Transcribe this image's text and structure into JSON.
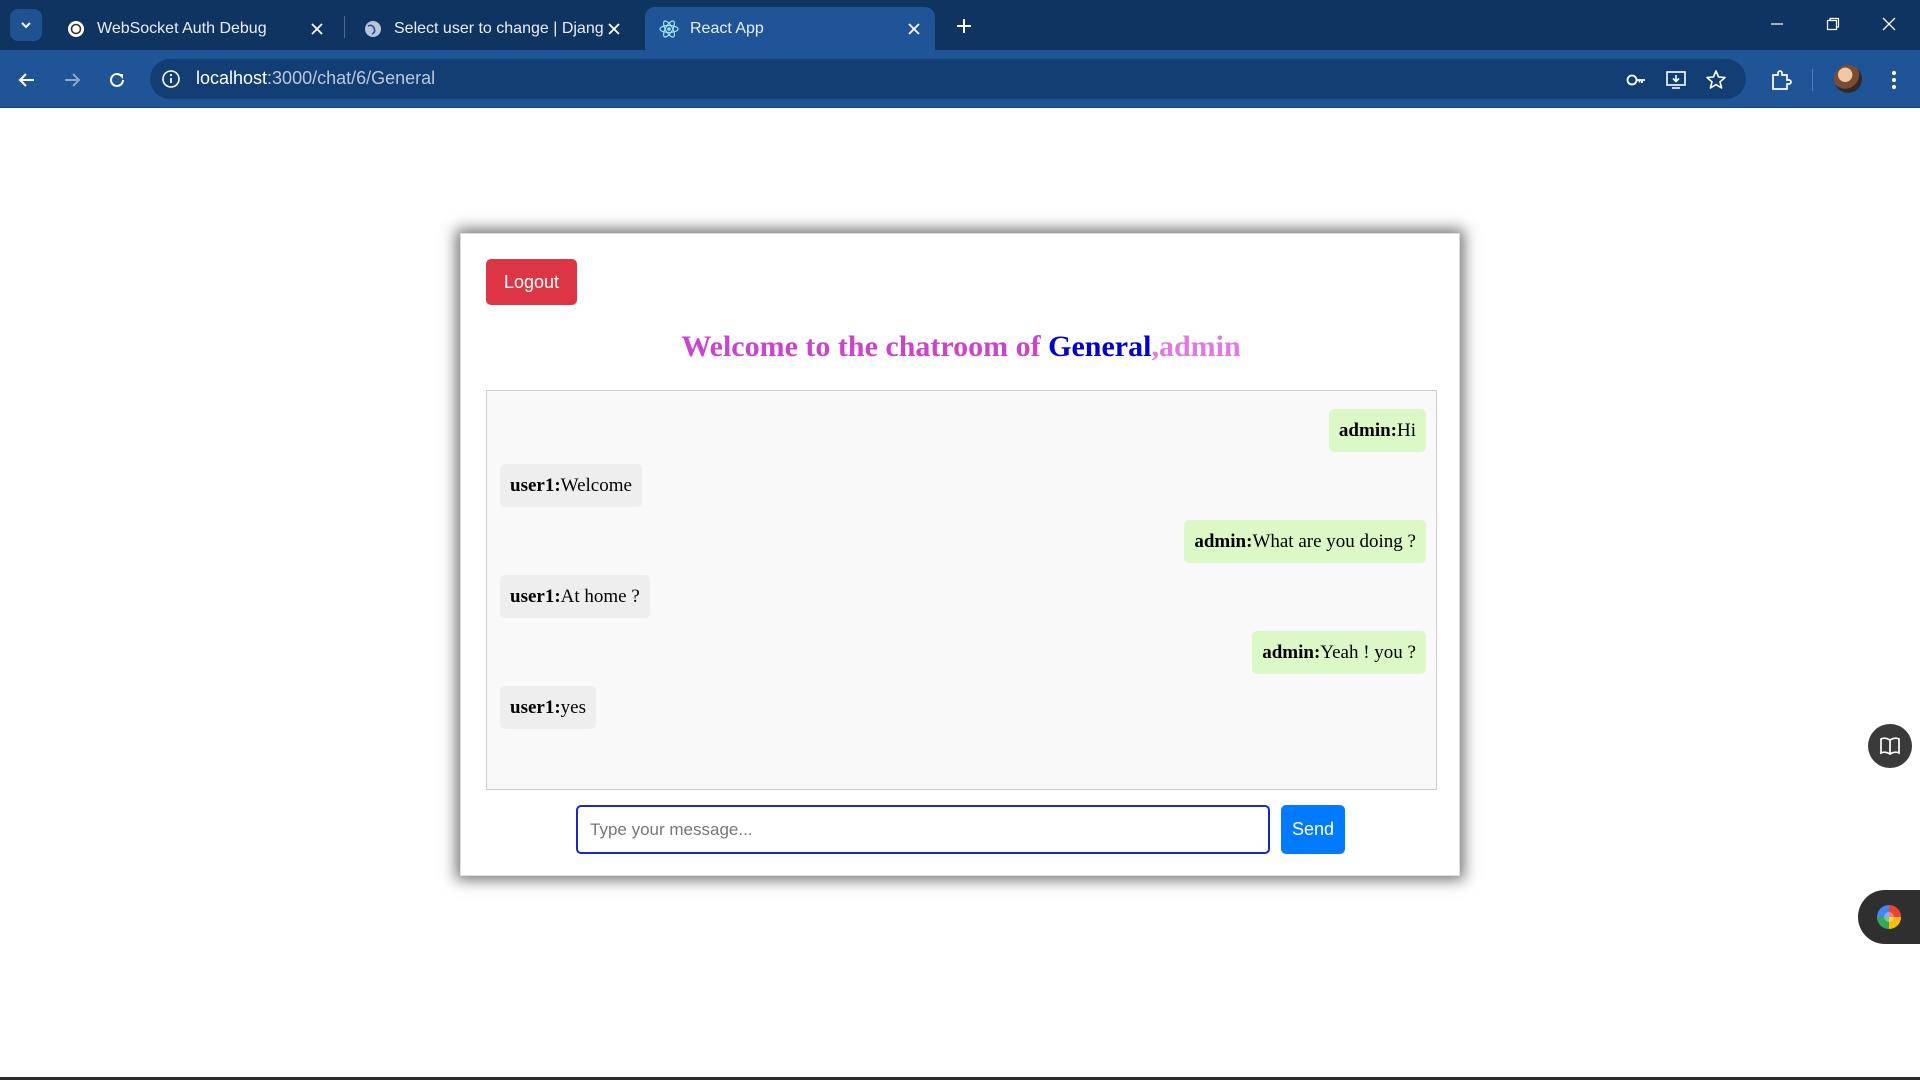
{
  "browser": {
    "tabs": [
      {
        "title": "WebSocket Auth Debug",
        "active": false
      },
      {
        "title": "Select user to change | Django",
        "active": false
      },
      {
        "title": "React App",
        "active": true
      }
    ],
    "url_host": "localhost",
    "url_path": ":3000/chat/6/General"
  },
  "colors": {
    "chrome_bg": "#0f3461",
    "toolbar_bg": "#1f5597",
    "logout": "#dc3545",
    "send": "#007bff",
    "sent_bubble": "#dcf8c6",
    "received_bubble": "#eeeeee"
  },
  "chat": {
    "logout_label": "Logout",
    "welcome_text": "Welcome to the chatroom of ",
    "room": "General",
    "separator": ",",
    "user": "admin",
    "messages": [
      {
        "sender": "admin:",
        "text": "Hi",
        "type": "sent"
      },
      {
        "sender": "user1:",
        "text": "Welcome",
        "type": "received"
      },
      {
        "sender": "admin:",
        "text": "What are you doing ?",
        "type": "sent"
      },
      {
        "sender": "user1:",
        "text": "At home ?",
        "type": "received"
      },
      {
        "sender": "admin:",
        "text": "Yeah ! you ?",
        "type": "sent"
      },
      {
        "sender": "user1:",
        "text": "yes",
        "type": "received"
      }
    ],
    "input_placeholder": "Type your message...",
    "send_label": "Send"
  },
  "icons": {
    "tab_search": "chevron-down-icon",
    "reading_mode": "book-icon",
    "assistant": "colorful-orb-icon"
  }
}
